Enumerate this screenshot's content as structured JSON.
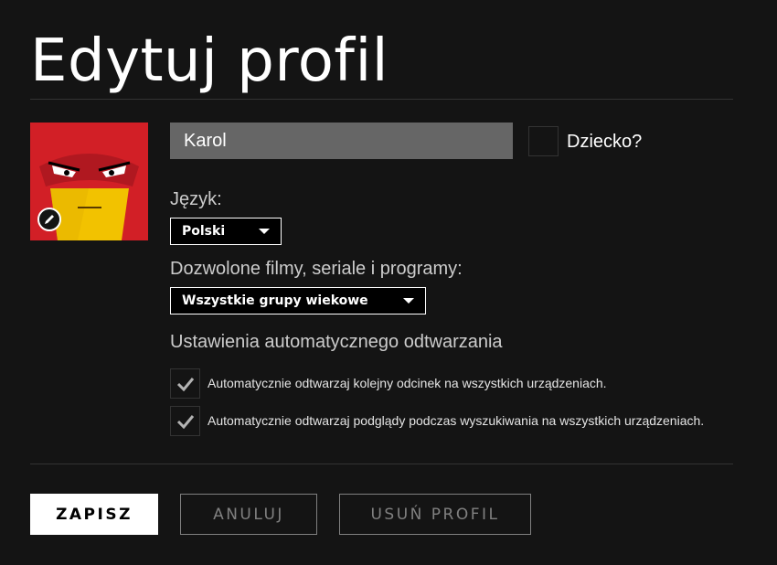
{
  "page": {
    "title": "Edytuj profil"
  },
  "profile": {
    "name_value": "Karol",
    "kid_label": "Dziecko?",
    "kid_checked": false
  },
  "language": {
    "label": "Język:",
    "selected": "Polski"
  },
  "maturity": {
    "label": "Dozwolone filmy, seriale i programy:",
    "selected": "Wszystkie grupy wiekowe"
  },
  "autoplay": {
    "heading": "Ustawienia automatycznego odtwarzania",
    "options": [
      {
        "label": "Automatycznie odtwarzaj kolejny odcinek na wszystkich urządzeniach.",
        "checked": true
      },
      {
        "label": "Automatycznie odtwarzaj podglądy podczas wyszukiwania na wszystkich urządzeniach.",
        "checked": true
      }
    ]
  },
  "actions": {
    "save_label": "ZAPISZ",
    "cancel_label": "ANULUJ",
    "delete_label": "USUŃ PROFIL"
  },
  "colors": {
    "background": "#141414",
    "avatar_bg": "#d21f26",
    "input_bg": "#666666"
  },
  "icons": {
    "avatar": "angry-cartoon-face-avatar",
    "edit": "pencil-icon",
    "check": "checkmark-icon",
    "caret": "caret-down-icon"
  }
}
